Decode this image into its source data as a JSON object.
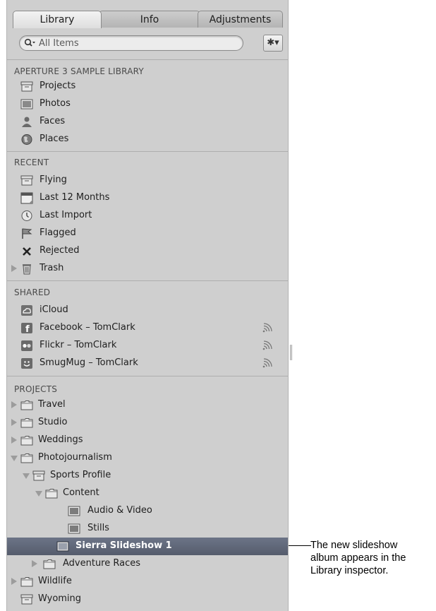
{
  "tabs": [
    "Library",
    "Info",
    "Adjustments"
  ],
  "search": {
    "placeholder": "All Items",
    "value": ""
  },
  "sections": {
    "library": "APERTURE 3 SAMPLE LIBRARY",
    "recent": "RECENT",
    "shared": "SHARED",
    "projects": "PROJECTS"
  },
  "library_items": [
    {
      "label": "Projects",
      "icon": "projects-icon"
    },
    {
      "label": "Photos",
      "icon": "photos-icon"
    },
    {
      "label": "Faces",
      "icon": "faces-icon"
    },
    {
      "label": "Places",
      "icon": "globe-icon"
    }
  ],
  "recent_items": [
    {
      "label": "Flying",
      "icon": "project-box-icon"
    },
    {
      "label": "Last 12 Months",
      "icon": "calendar-icon"
    },
    {
      "label": "Last Import",
      "icon": "clock-icon"
    },
    {
      "label": "Flagged",
      "icon": "flag-icon"
    },
    {
      "label": "Rejected",
      "icon": "x-icon"
    },
    {
      "label": "Trash",
      "icon": "trash-icon"
    }
  ],
  "shared_items": [
    {
      "label": "iCloud",
      "icon": "icloud-icon"
    },
    {
      "label": "Facebook – TomClark",
      "icon": "facebook-icon"
    },
    {
      "label": "Flickr – TomClark",
      "icon": "flickr-icon"
    },
    {
      "label": "SmugMug – TomClark",
      "icon": "smugmug-icon"
    }
  ],
  "project_items": [
    {
      "label": "Travel"
    },
    {
      "label": "Studio"
    },
    {
      "label": "Weddings"
    },
    {
      "label": "Photojournalism"
    },
    {
      "label": "Sports Profile"
    },
    {
      "label": "Content"
    },
    {
      "label": "Audio & Video"
    },
    {
      "label": "Stills"
    },
    {
      "label": "Sierra Slideshow 1"
    },
    {
      "label": "Adventure Races"
    },
    {
      "label": "Wildlife"
    },
    {
      "label": "Wyoming"
    }
  ],
  "callout": {
    "line1": "The new slideshow",
    "line2": "album appears in the",
    "line3": "Library inspector."
  },
  "colors": {
    "panel": "#cfcfcf",
    "selection": "#5f6677",
    "selection_text": "#ffffff"
  }
}
